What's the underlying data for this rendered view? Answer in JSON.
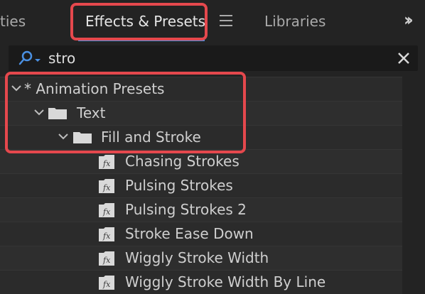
{
  "tabs": {
    "properties_partial": "ties",
    "effects": "Effects & Presets",
    "libraries": "Libraries"
  },
  "search": {
    "value": "stro"
  },
  "tree": {
    "root": "* Animation Presets",
    "folder_text": "Text",
    "folder_fill_stroke": "Fill and Stroke",
    "presets": [
      "Chasing Strokes",
      "Pulsing Strokes",
      "Pulsing Strokes 2",
      "Stroke Ease Down",
      "Wiggly Stroke Width",
      "Wiggly Stroke Width By Line"
    ]
  },
  "colors": {
    "accent": "#4a90e2",
    "highlight": "#e5484d"
  }
}
